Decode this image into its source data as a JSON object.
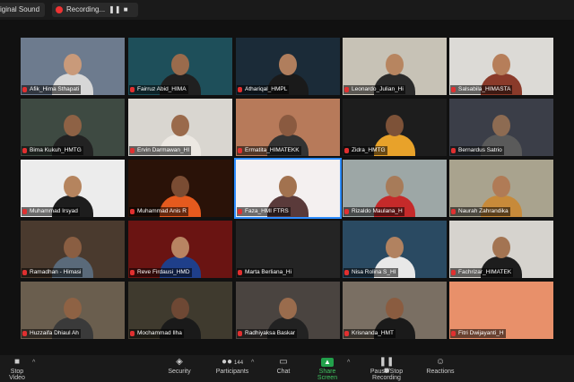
{
  "topbar": {
    "sound_label": "iginal Sound",
    "recording_label": "Recording..."
  },
  "participants": [
    {
      "name": "Afik_Hima Sthapati",
      "bg": "#6d7b8e",
      "skin": "#c99a7a",
      "shirt": "#d7d7d7"
    },
    {
      "name": "Fairruz Abid_HIMA",
      "bg": "#1e4f5a",
      "skin": "#9a6b4c",
      "shirt": "#202020"
    },
    {
      "name": "Athariqal_HMPL",
      "bg": "#1b2b38",
      "skin": "#b07e5d",
      "shirt": "#1a1a1a"
    },
    {
      "name": "Leonardo_Julian_Hi",
      "bg": "#c7c2b6",
      "skin": "#b78560",
      "shirt": "#2a2a2a"
    },
    {
      "name": "Salsabila_HIMASTA",
      "bg": "#dcdad6",
      "skin": "#b67e5a",
      "shirt": "#8a3a2a"
    },
    {
      "name": "Bima Kukuh_HMTG",
      "bg": "#3e4a42",
      "skin": "#8e6245",
      "shirt": "#222"
    },
    {
      "name": "Ervin Darmawan_HI",
      "bg": "#d9d6d0",
      "skin": "#9a6a4b",
      "shirt": "#ece8e2"
    },
    {
      "name": "Ermatita_HIMATEKK",
      "bg": "#b77a5a",
      "skin": "#8a5a40",
      "shirt": "#333"
    },
    {
      "name": "Zidra_HMTG",
      "bg": "#1d1d1d",
      "skin": "#7d5238",
      "shirt": "#e8a22a"
    },
    {
      "name": "Bernardus Satrio",
      "bg": "#3b3e48",
      "skin": "#8d6b52",
      "shirt": "#5a5a5a"
    },
    {
      "name": "Muhammad Irsyad",
      "bg": "#ececec",
      "skin": "#b5845e",
      "shirt": "#1d1d1d"
    },
    {
      "name": "Muhammad Anis R",
      "bg": "#2a1208",
      "skin": "#7a4c33",
      "shirt": "#e55a1e"
    },
    {
      "name": "Faza_HMI FTRS",
      "bg": "#f4f0f0",
      "skin": "#a2724f",
      "shirt": "#5a3a3a"
    },
    {
      "name": "Rizaldo Maulana_H",
      "bg": "#9da7a6",
      "skin": "#a77b59",
      "shirt": "#c52a2a"
    },
    {
      "name": "Naurah Zahrandika",
      "bg": "#a9a38e",
      "skin": "#b07b56",
      "shirt": "#c78a3a"
    },
    {
      "name": "Ramadhan - Himasi",
      "bg": "#4a3a2e",
      "skin": "#8a5e42",
      "shirt": "#5a6a7a"
    },
    {
      "name": "Reve Firdausi_HMD",
      "bg": "#6a1412",
      "skin": "#b88462",
      "shirt": "#1f3f8a"
    },
    {
      "name": "Marta Berliana_Hi",
      "bg": "#242424",
      "skin": "",
      "shirt": ""
    },
    {
      "name": "Nisa Rolina S_HI",
      "bg": "#2a4a62",
      "skin": "#b18260",
      "shirt": "#e8e8e8"
    },
    {
      "name": "Fachrizar_HIMATEK",
      "bg": "#d6d3ce",
      "skin": "#a37452",
      "shirt": "#1d1d1d"
    },
    {
      "name": "Huzzaifa Dhiaul Ah",
      "bg": "#6a5e4e",
      "skin": "#8e6244",
      "shirt": "#3a3a3a"
    },
    {
      "name": "Mochammad Ilha",
      "bg": "#3f3a2e",
      "skin": "#6e4834",
      "shirt": "#1a1a1a"
    },
    {
      "name": "Radhiyaksa Baskar",
      "bg": "#4a4440",
      "skin": "#9a6c4d",
      "shirt": "#222"
    },
    {
      "name": "Krisnanda_HMT",
      "bg": "#7a6f63",
      "skin": "#8a5c40",
      "shirt": "#1a1a1a"
    },
    {
      "name": "Fitri Dwijayanti_H",
      "bg": "#e8906a",
      "skin": "",
      "shirt": ""
    }
  ],
  "toolbar": {
    "stop_video": "Stop Video",
    "security": "Security",
    "participants": "Participants",
    "participants_count": "144",
    "chat": "Chat",
    "share_screen": "Share Screen",
    "record": "Pause/Stop Recording",
    "reactions": "Reactions"
  },
  "colors": {
    "accent": "#2d8cff",
    "recording": "#e33333",
    "share": "#22a04b",
    "muted": "#e03030"
  }
}
